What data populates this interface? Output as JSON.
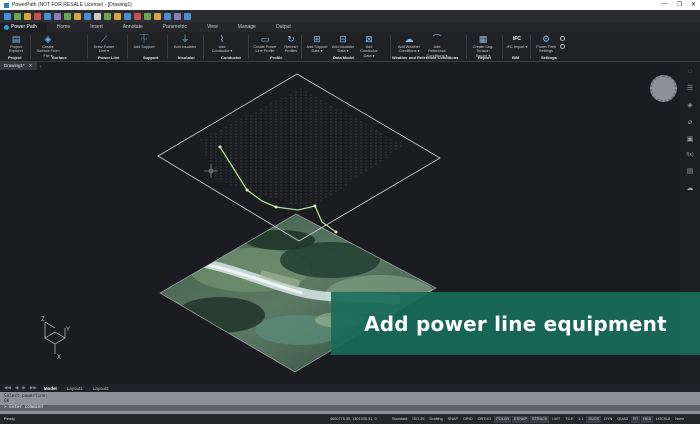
{
  "window": {
    "title": "PowerPath (NOT FOR RESALE License) - [Drawing1]",
    "controls": [
      "—",
      "❐",
      "✕"
    ]
  },
  "quick_access": {
    "colors": [
      "#4a90d9",
      "#6aa84f",
      "#d9a441",
      "#c94f4f",
      "#4a90d9",
      "#8e7cc3",
      "#6aa84f",
      "#d9a441",
      "#4a90d9",
      "#cccccc",
      "#6aa84f",
      "#d9a441",
      "#4a90d9",
      "#c94f4f",
      "#6aa84f",
      "#d9a441",
      "#4a90d9",
      "#8e7cc3",
      "#4a90d9"
    ]
  },
  "ribbon_tabs": [
    "Home",
    "Insert",
    "Annotate",
    "Parametric",
    "View",
    "Manage",
    "Output"
  ],
  "ribbon_logo": "Power Path",
  "ribbon": {
    "items": [
      {
        "label": "Project Explorer",
        "icon": "folder-icon",
        "glyph": "▤"
      },
      {
        "label": "Create Surface From File ▾",
        "icon": "surface-icon",
        "glyph": "◈"
      },
      {
        "label": "Draw Power Line ▾",
        "icon": "power-line-icon",
        "glyph": "⟋"
      },
      {
        "label": "Add Support",
        "icon": "tower-icon",
        "glyph": "⏇"
      },
      {
        "label": "Add Insulator",
        "icon": "insulator-icon",
        "glyph": "⏚"
      },
      {
        "label": "Add Conductor ▾",
        "icon": "conductor-icon",
        "glyph": "⌇"
      },
      {
        "label": "Create Power Line Profile",
        "icon": "profile-icon",
        "glyph": "▭"
      },
      {
        "label": "Refresh Profiles",
        "icon": "refresh-icon",
        "glyph": "↻"
      },
      {
        "label": "Add Support Data ▾",
        "icon": "support-data-icon",
        "glyph": "⊞"
      },
      {
        "label": "Add Insulator Data ▾",
        "icon": "insulator-data-icon",
        "glyph": "⊟"
      },
      {
        "label": "Add Conductor Data ▾",
        "icon": "conductor-data-icon",
        "glyph": "⊠"
      },
      {
        "label": "Add Weather Conditions ▾",
        "icon": "weather-icon",
        "glyph": "☁"
      },
      {
        "label": "Add Reference Conditions ▾",
        "icon": "reference-icon",
        "glyph": "⌒"
      },
      {
        "label": "Create Sag-Tension Report ▾",
        "icon": "report-icon",
        "glyph": "▦"
      },
      {
        "label": "IFC Import ▾",
        "icon": "ifc-icon",
        "glyph": "IFC"
      },
      {
        "label": "Power Path Settings",
        "icon": "settings-icon",
        "glyph": "⚙"
      }
    ],
    "groups": [
      "Project",
      "Surface",
      "Power Line",
      "Support",
      "Insulator",
      "Conductor",
      "Profile",
      "Data Model",
      "Weather and Reference Conditions",
      "Report",
      "BIM",
      "Settings"
    ]
  },
  "document_tab": {
    "label": "Drawing1*",
    "close": "✕",
    "add": "+"
  },
  "right_toolbar": {
    "icons": [
      {
        "name": "lightbulb-icon",
        "glyph": "◌"
      },
      {
        "name": "properties-icon",
        "glyph": "☰"
      },
      {
        "name": "layers-icon",
        "glyph": "◈"
      },
      {
        "name": "attach-icon",
        "glyph": "⌀"
      },
      {
        "name": "blocks-icon",
        "glyph": "▣"
      },
      {
        "name": "formula-icon",
        "glyph": "f(x)"
      },
      {
        "name": "data-icon",
        "glyph": "▤"
      },
      {
        "name": "cloud-icon",
        "glyph": "☁"
      }
    ]
  },
  "axis_labels": {
    "x": "X",
    "y": "Y",
    "z": "Z"
  },
  "callout": "Add power line equipment",
  "layout_tabs": {
    "arrows": [
      "◀◀",
      "◀",
      "▶",
      "▶▶"
    ],
    "tabs": [
      "Model",
      "Layout1",
      "Layout2"
    ],
    "active": "Model"
  },
  "command_line": {
    "history": [
      "Select powerline:",
      "Ok"
    ],
    "prompt": "> Enter command"
  },
  "status_bar": {
    "ready": "Ready",
    "coords": "4600775.35, 1301305.31, 0",
    "items": [
      "Standard",
      "ISO-25",
      "Drafting",
      "SNAP",
      "GRID",
      "ORTHO",
      "POLAR",
      "ESNAP",
      "STRACK",
      "LWT",
      "TILE",
      "1:1",
      "DUCS",
      "DYN",
      "QUAD",
      "RT",
      "HKA",
      "LOCKUI",
      "None"
    ],
    "active": [
      "POLAR",
      "ESNAP",
      "STRACK",
      "DUCS",
      "RT",
      "HKA"
    ]
  },
  "colors": {
    "viewport_bg": "#1a1c1f",
    "callout_bg": "#186c58",
    "power_line": "#9ed07a"
  }
}
